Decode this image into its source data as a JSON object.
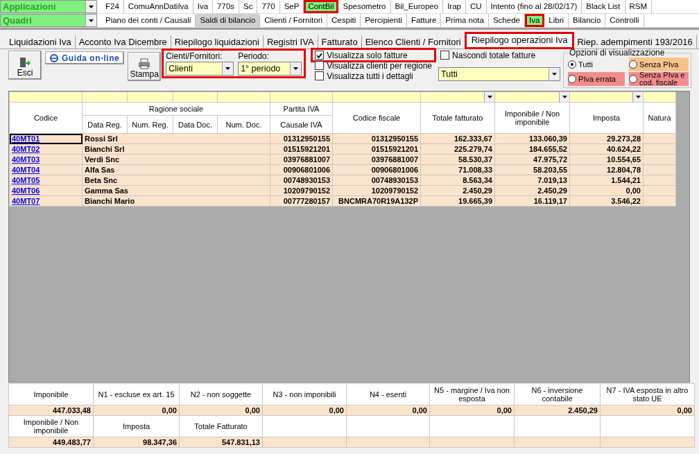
{
  "menu_rows": [
    {
      "selector": "Applicazioni",
      "items": [
        {
          "label": "F24",
          "selected": false,
          "pressed": false,
          "highlighted": false
        },
        {
          "label": "ComuAnnDatiIva",
          "selected": false,
          "pressed": false,
          "highlighted": false
        },
        {
          "label": "Iva",
          "selected": false,
          "pressed": false,
          "highlighted": false
        },
        {
          "label": "770s",
          "selected": false,
          "pressed": false,
          "highlighted": false
        },
        {
          "label": "Sc",
          "selected": false,
          "pressed": false,
          "highlighted": false
        },
        {
          "label": "770",
          "selected": false,
          "pressed": false,
          "highlighted": false
        },
        {
          "label": "SeP",
          "selected": false,
          "pressed": false,
          "highlighted": false
        },
        {
          "label": "ContBil",
          "selected": true,
          "pressed": false,
          "highlighted": true
        },
        {
          "label": "Spesometro",
          "selected": false,
          "pressed": false,
          "highlighted": false
        },
        {
          "label": "Bil_Europeo",
          "selected": false,
          "pressed": false,
          "highlighted": false
        },
        {
          "label": "Irap",
          "selected": false,
          "pressed": false,
          "highlighted": false
        },
        {
          "label": "CU",
          "selected": false,
          "pressed": false,
          "highlighted": false
        },
        {
          "label": "Intento (fino al 28/02/17)",
          "selected": false,
          "pressed": false,
          "highlighted": false
        },
        {
          "label": "Black List",
          "selected": false,
          "pressed": false,
          "highlighted": false
        },
        {
          "label": "RSM",
          "selected": false,
          "pressed": false,
          "highlighted": false
        }
      ]
    },
    {
      "selector": "Quadri",
      "items": [
        {
          "label": "Piano dei conti / Causali",
          "selected": false,
          "pressed": false,
          "highlighted": false
        },
        {
          "label": "Saldi di bilancio",
          "selected": false,
          "pressed": true,
          "highlighted": false
        },
        {
          "label": "Clienti / Fornitori",
          "selected": false,
          "pressed": false,
          "highlighted": false
        },
        {
          "label": "Cespiti",
          "selected": false,
          "pressed": false,
          "highlighted": false
        },
        {
          "label": "Percipienti",
          "selected": false,
          "pressed": false,
          "highlighted": false
        },
        {
          "label": "Fatture",
          "selected": false,
          "pressed": false,
          "highlighted": false
        },
        {
          "label": "Prima nota",
          "selected": false,
          "pressed": false,
          "highlighted": false
        },
        {
          "label": "Schede",
          "selected": false,
          "pressed": false,
          "highlighted": false
        },
        {
          "label": "Iva",
          "selected": true,
          "pressed": false,
          "highlighted": true
        },
        {
          "label": "Libri",
          "selected": false,
          "pressed": false,
          "highlighted": false
        },
        {
          "label": "Bilancio",
          "selected": false,
          "pressed": false,
          "highlighted": false
        },
        {
          "label": "Controlli",
          "selected": false,
          "pressed": false,
          "highlighted": false
        }
      ]
    }
  ],
  "tabs": [
    {
      "label": "Liquidazioni Iva",
      "selected": false,
      "highlighted": false
    },
    {
      "label": "Acconto Iva Dicembre",
      "selected": false,
      "highlighted": false
    },
    {
      "label": "Riepilogo liquidazioni",
      "selected": false,
      "highlighted": false
    },
    {
      "label": "Registri IVA",
      "selected": false,
      "highlighted": false
    },
    {
      "label": "Fatturato",
      "selected": false,
      "highlighted": false
    },
    {
      "label": "Elenco Clienti / Fornitori",
      "selected": false,
      "highlighted": false
    },
    {
      "label": "Riepilogo operazioni Iva",
      "selected": true,
      "highlighted": true
    },
    {
      "label": "Riep. adempimenti 193/2016",
      "selected": false,
      "highlighted": false
    }
  ],
  "toolbar": {
    "exit_button": "Esci",
    "help_button": "Guida on-line",
    "print_button": "Stampa"
  },
  "filters": {
    "highlighted": true,
    "party_label": "Cienti/Fornitori:",
    "party_value": "Clienti",
    "period_label": "Periodo:",
    "period_value": "1° periodo"
  },
  "view_checkboxes": [
    {
      "label": "Visualizza solo fatture",
      "checked": true,
      "highlighted": true
    },
    {
      "label": "Visualizza clienti per regione",
      "checked": false,
      "highlighted": false
    },
    {
      "label": "Visualizza tutti i dettagli",
      "checked": false,
      "highlighted": false
    }
  ],
  "hide_totals": {
    "label": "Nascondi totale fatture",
    "checked": false
  },
  "type_select": {
    "value": "Tutti"
  },
  "display_options": {
    "title": "Opzioni di visualizzazione",
    "options": [
      {
        "label": "Tutti",
        "selected": true,
        "color": "#f0f0f0"
      },
      {
        "label": "Senza PIva",
        "selected": false,
        "color": "#f9c48b"
      },
      {
        "label": "PIva errata",
        "selected": false,
        "color": "#f28c8c"
      },
      {
        "label": "Senza PIva e cod. fiscale",
        "selected": false,
        "color": "#f28c8c"
      }
    ]
  },
  "table": {
    "headers": {
      "codice": "Codice",
      "ragione_sociale": "Ragione sociale",
      "data_reg": "Data Reg.",
      "num_reg": "Num. Reg.",
      "data_doc": "Data Doc.",
      "num_doc": "Num. Doc.",
      "partita_iva": "Partita IVA",
      "causale_iva": "Causale IVA",
      "codice_fiscale": "Codice fiscale",
      "totale_fatturato": "Totale fatturato",
      "imponibile": "Imponibile / Non imponibile",
      "imposta": "Imposta",
      "natura": "Natura"
    },
    "rows": [
      {
        "codice": "40MT01",
        "ragione_sociale": "Rossi Srl",
        "partita_iva": "01312950155",
        "codice_fiscale": "01312950155",
        "totale": "162.333,67",
        "imponibile": "133.060,39",
        "imposta": "29.273,28",
        "selected": true
      },
      {
        "codice": "40MT02",
        "ragione_sociale": "Bianchi Srl",
        "partita_iva": "01515921201",
        "codice_fiscale": "01515921201",
        "totale": "225.279,74",
        "imponibile": "184.655,52",
        "imposta": "40.624,22",
        "selected": false
      },
      {
        "codice": "40MT03",
        "ragione_sociale": "Verdi Snc",
        "partita_iva": "03976881007",
        "codice_fiscale": "03976881007",
        "totale": "58.530,37",
        "imponibile": "47.975,72",
        "imposta": "10.554,65",
        "selected": false
      },
      {
        "codice": "40MT04",
        "ragione_sociale": "Alfa Sas",
        "partita_iva": "00906801006",
        "codice_fiscale": "00906801006",
        "totale": "71.008,33",
        "imponibile": "58.203,55",
        "imposta": "12.804,78",
        "selected": false
      },
      {
        "codice": "40MT05",
        "ragione_sociale": "Beta Snc",
        "partita_iva": "00748930153",
        "codice_fiscale": "00748930153",
        "totale": "8.563,34",
        "imponibile": "7.019,13",
        "imposta": "1.544,21",
        "selected": false
      },
      {
        "codice": "40MT06",
        "ragione_sociale": "Gamma Sas",
        "partita_iva": "10209790152",
        "codice_fiscale": "10209790152",
        "totale": "2.450,29",
        "imponibile": "2.450,29",
        "imposta": "0,00",
        "selected": false
      },
      {
        "codice": "40MT07",
        "ragione_sociale": "Bianchi Mario",
        "partita_iva": "00777280157",
        "codice_fiscale": "BNCMRA70R19A132P",
        "totale": "19.665,39",
        "imponibile": "16.119,17",
        "imposta": "3.546,22",
        "selected": false
      }
    ]
  },
  "totals": [
    {
      "headers": [
        "Imponibile",
        "N1 - escluse ex art. 15",
        "N2 - non soggette",
        "N3 - non imponibili",
        "N4 - esenti",
        "N5 - margine / Iva non esposta",
        "N6 - inversione contabile",
        "N7 - IVA esposta in altro stato UE"
      ],
      "values": [
        "447.033,48",
        "0,00",
        "0,00",
        "0,00",
        "0,00",
        "0,00",
        "2.450,29",
        "0,00"
      ]
    },
    {
      "headers": [
        "Imponibile / Non imponibile",
        "Imposta",
        "Totale Fatturato"
      ],
      "values": [
        "449.483,77",
        "98.347,36",
        "547.831,13"
      ]
    }
  ]
}
